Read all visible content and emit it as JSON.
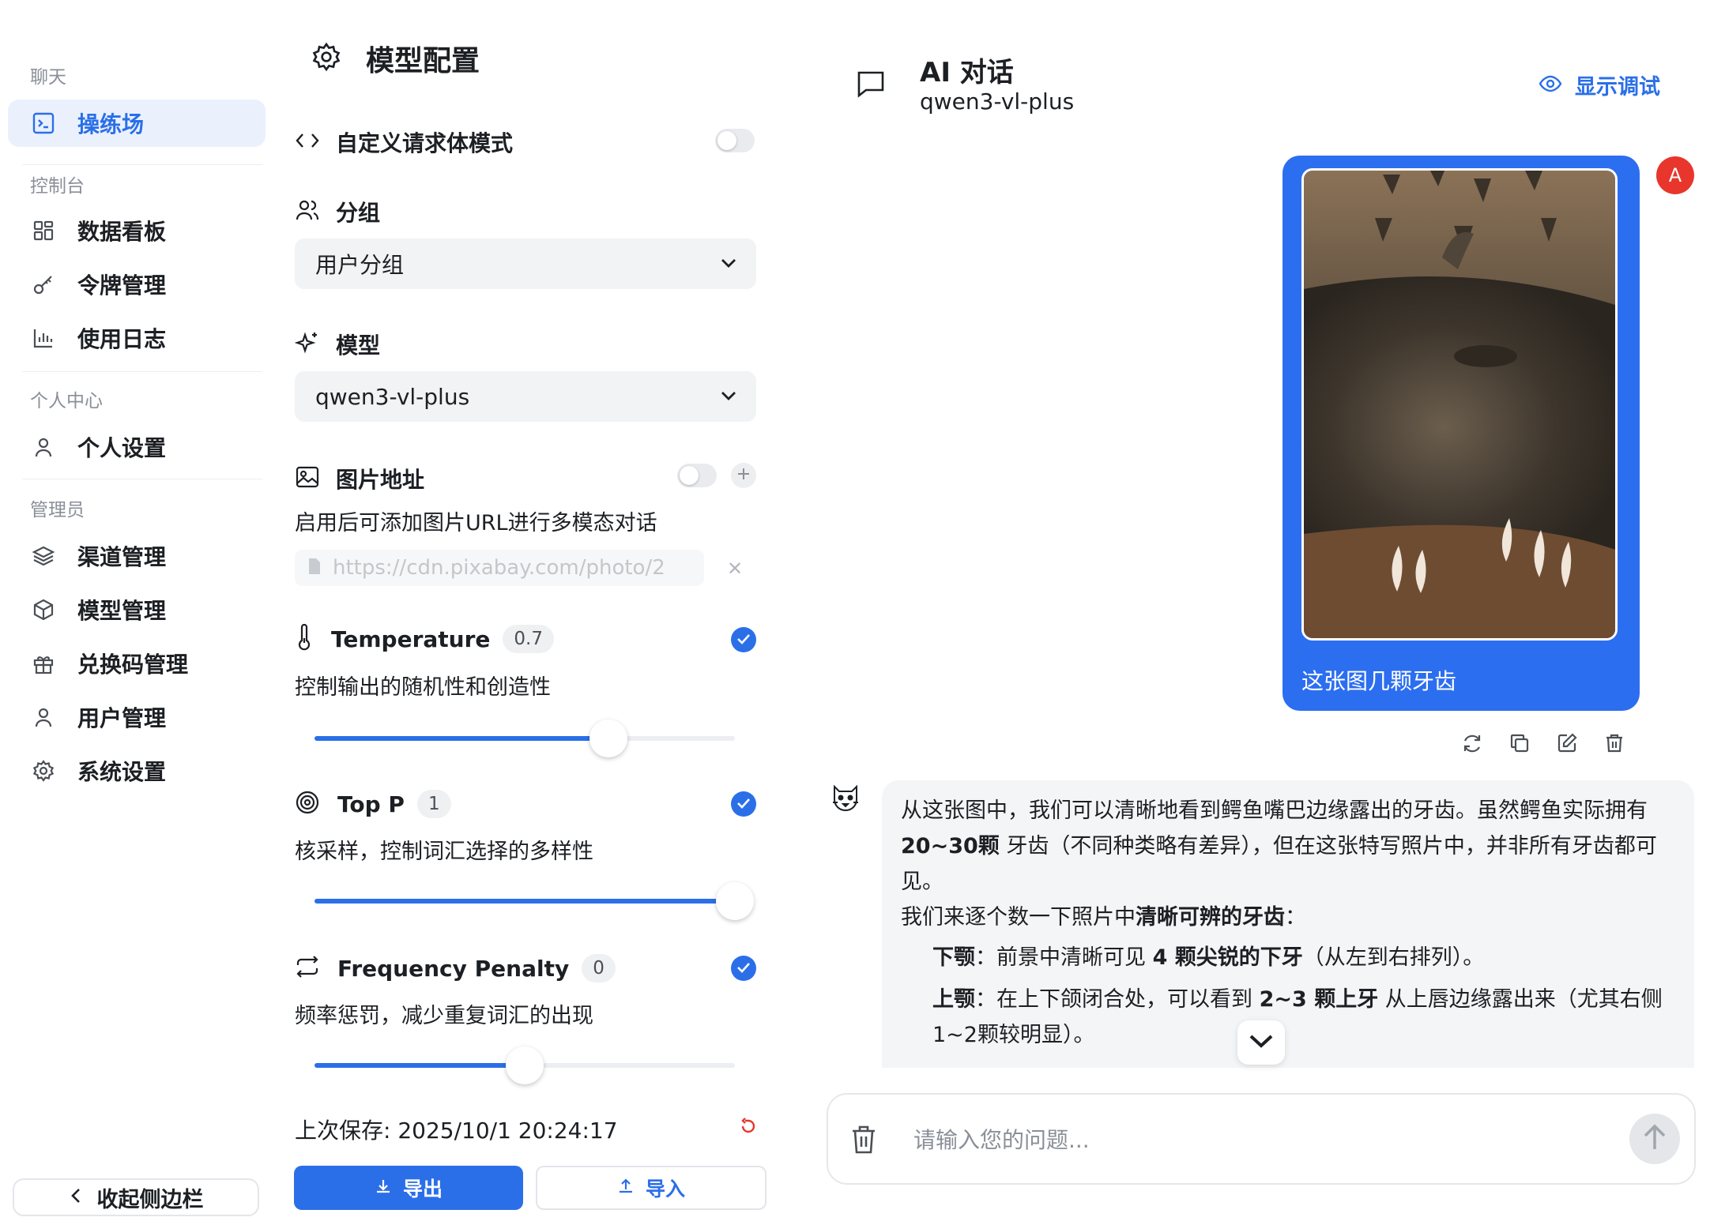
{
  "sidebar": {
    "sections": [
      "聊天",
      "控制台",
      "个人中心",
      "管理员"
    ],
    "items": [
      {
        "label": "操练场",
        "icon": "terminal-icon",
        "active": true
      },
      {
        "label": "数据看板",
        "icon": "dashboard-icon"
      },
      {
        "label": "令牌管理",
        "icon": "key-icon"
      },
      {
        "label": "使用日志",
        "icon": "bar-chart-icon"
      },
      {
        "label": "个人设置",
        "icon": "user-icon"
      },
      {
        "label": "渠道管理",
        "icon": "layers-icon"
      },
      {
        "label": "模型管理",
        "icon": "box-icon"
      },
      {
        "label": "兑换码管理",
        "icon": "gift-icon"
      },
      {
        "label": "用户管理",
        "icon": "user-icon"
      },
      {
        "label": "系统设置",
        "icon": "gear-icon"
      }
    ],
    "collapse_label": "收起侧边栏"
  },
  "config": {
    "title": "模型配置",
    "custom_body_label": "自定义请求体模式",
    "group_label": "分组",
    "group_value": "用户分组",
    "model_label": "模型",
    "model_value": "qwen3-vl-plus",
    "image_label": "图片地址",
    "image_desc": "启用后可添加图片URL进行多模态对话",
    "image_url_placeholder": "https://cdn.pixabay.com/photo/2",
    "params": [
      {
        "name": "Temperature",
        "value": "0.7",
        "desc": "控制输出的随机性和创造性",
        "level": 0.7
      },
      {
        "name": "Top P",
        "value": "1",
        "desc": "核采样，控制词汇选择的多样性",
        "level": 1.0
      },
      {
        "name": "Frequency Penalty",
        "value": "0",
        "desc": "频率惩罚，减少重复词汇的出现",
        "level": 0.5
      }
    ],
    "last_saved": "上次保存: 2025/10/1 20:24:17",
    "export_label": "导出",
    "import_label": "导入"
  },
  "chat": {
    "title": "AI 对话",
    "subtitle": "qwen3-vl-plus",
    "debug_label": "显示调试",
    "user_avatar": "A",
    "user_message": "这张图几颗牙齿",
    "bot": {
      "p1_a": "从这张图中，我们可以清晰地看到鳄鱼嘴巴边缘露出的牙齿。虽然鳄鱼实际拥有",
      "p1_b": "20~30颗",
      "p1_c": " 牙齿（不同种类略有差异），但在这张特写照片中，并非所有牙齿都可见。",
      "p2_a": "我们来逐个数一下照片中",
      "p2_b": "清晰可辨的牙齿",
      "p2_c": "：",
      "li1_a": "下颚",
      "li1_b": "：前景中清晰可见 ",
      "li1_c": "4 颗尖锐的下牙",
      "li1_d": "（从左到右排列）。",
      "li2_a": "上颚",
      "li2_b": "：在上下颌闭合处，可以看到 ",
      "li2_c": "2~3 颗上牙",
      "li2_d": " 从上唇边缘露出来（尤其右侧1~2颗较明显）。"
    },
    "input_placeholder": "请输入您的问题..."
  },
  "colors": {
    "accent": "#2b6fe8",
    "user_bubble": "#2c6ef0",
    "avatar": "#e8362c"
  }
}
